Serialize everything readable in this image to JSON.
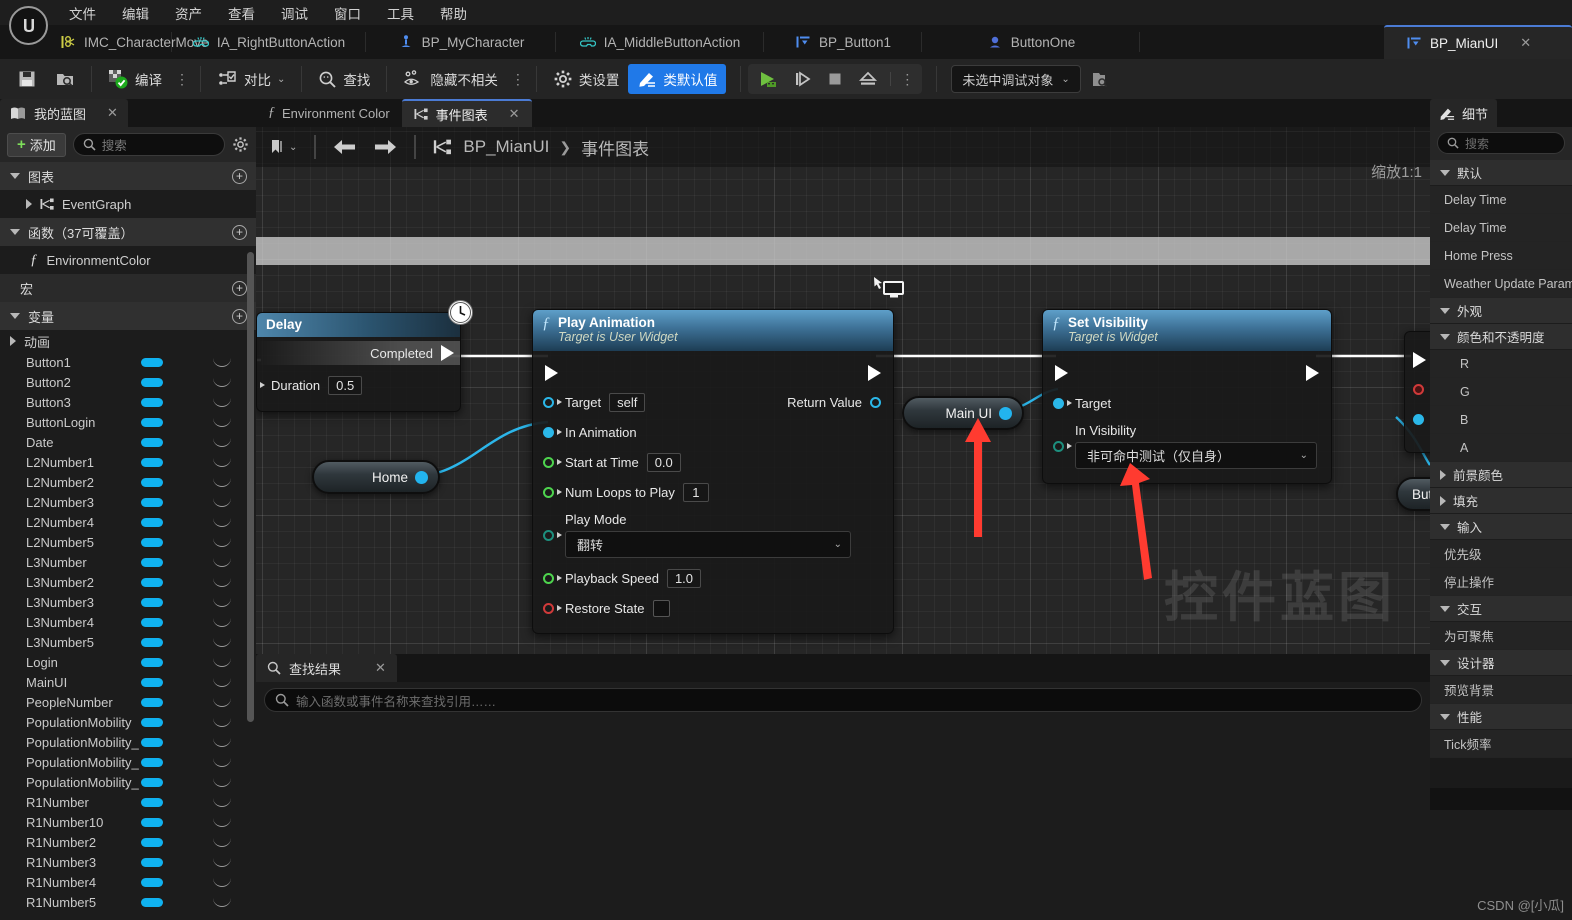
{
  "menubar": {
    "logo_icon": "unreal-engine-logo",
    "items": [
      "文件",
      "编辑",
      "资产",
      "查看",
      "调试",
      "窗口",
      "工具",
      "帮助"
    ]
  },
  "asset_tabs": [
    {
      "label": "IMC_CharacterMove",
      "icon": "input-mapping-context-icon",
      "active": false
    },
    {
      "label": "IA_RightButtonAction",
      "icon": "input-action-icon",
      "active": false
    },
    {
      "label": "BP_MyCharacter",
      "icon": "character-blueprint-icon",
      "active": false
    },
    {
      "label": "IA_MiddleButtonAction",
      "icon": "input-action-icon",
      "active": false
    },
    {
      "label": "BP_Button1",
      "icon": "widget-blueprint-icon",
      "active": false
    },
    {
      "label": "ButtonOne",
      "icon": "button-widget-icon",
      "active": false
    },
    {
      "label": "BP_MianUI",
      "icon": "widget-blueprint-icon",
      "active": true,
      "close_label": "✕"
    }
  ],
  "toolbar": {
    "save_icon": "save-icon",
    "browse_icon": "browse-content-icon",
    "compile_label": "编译",
    "compile_icon": "compile-check-icon",
    "diff_label": "对比",
    "diff_icon": "diff-icon",
    "find_label": "查找",
    "find_icon": "search-icon",
    "hide_unrelated_label": "隐藏不相关",
    "hide_unrelated_icon": "eye-hidden-icon",
    "class_settings_label": "类设置",
    "class_settings_icon": "gear-icon",
    "class_defaults_label": "类默认值",
    "class_defaults_icon": "pencil-lines-icon",
    "accent_color": "#2079e8",
    "play_icon": "play-icon",
    "step_icon": "step-forward-icon",
    "stop_icon": "stop-icon",
    "eject_icon": "eject-icon",
    "kebab": "⋮",
    "debug_object_label": "未选中调试对象",
    "debug_browse_icon": "browse-debug-icon"
  },
  "left_panel": {
    "tab_label": "我的蓝图",
    "tab_icon": "my-blueprint-icon",
    "tab_close": "✕",
    "add_label": "添加",
    "search_placeholder": "搜索",
    "settings_icon": "gear-icon",
    "sections": {
      "graphs_label": "图表",
      "graphs_items": [
        "EventGraph"
      ],
      "functions_label": "函数（37可覆盖）",
      "functions_items": [
        "EnvironmentColor"
      ],
      "macros_label": "宏",
      "variables_label": "变量",
      "animation_label": "动画"
    },
    "variables": [
      "Button1",
      "Button2",
      "Button3",
      "ButtonLogin",
      "Date",
      "L2Number1",
      "L2Number2",
      "L2Number3",
      "L2Number4",
      "L2Number5",
      "L3Number",
      "L3Number2",
      "L3Number3",
      "L3Number4",
      "L3Number5",
      "Login",
      "MainUI",
      "PeopleNumber",
      "PopulationMobility",
      "PopulationMobility_",
      "PopulationMobility_",
      "PopulationMobility_",
      "R1Number",
      "R1Number10",
      "R1Number2",
      "R1Number3",
      "R1Number4",
      "R1Number5"
    ],
    "variable_pill_color": "#10b2f0"
  },
  "graph": {
    "tabs": [
      {
        "label": "Environment Color",
        "icon": "function-fx-icon",
        "active": false
      },
      {
        "label": "事件图表",
        "icon": "event-graph-icon",
        "active": true,
        "close_label": "✕"
      }
    ],
    "breadcrumb": {
      "root": "BP_MianUI",
      "separator": "❯",
      "current": "事件图表",
      "icon": "event-graph-icon"
    },
    "nav_back_icon": "arrow-left-icon",
    "nav_forward_icon": "arrow-right-icon",
    "bookmark_icon": "bookmark-icon",
    "zoom_label": "缩放1:1",
    "watermark": "控件蓝图"
  },
  "nodes": {
    "delay": {
      "title": "Delay",
      "clock_icon": "clock-latent-icon",
      "output_exec_label": "Completed",
      "duration_label": "Duration",
      "duration_value": "0.5"
    },
    "play_animation": {
      "title": "Play Animation",
      "subtitle": "Target is User Widget",
      "fx_icon": "function-fx-icon",
      "target_label": "Target",
      "target_value": "self",
      "in_animation_label": "In Animation",
      "start_at_time_label": "Start at Time",
      "start_at_time_value": "0.0",
      "num_loops_label": "Num Loops to Play",
      "num_loops_value": "1",
      "play_mode_label": "Play Mode",
      "play_mode_value": "翻转",
      "playback_speed_label": "Playback Speed",
      "playback_speed_value": "1.0",
      "restore_state_label": "Restore State",
      "return_value_label": "Return Value"
    },
    "set_visibility": {
      "title": "Set Visibility",
      "subtitle": "Target is Widget",
      "fx_icon": "function-fx-icon",
      "target_label": "Target",
      "in_visibility_label": "In Visibility",
      "in_visibility_value": "非可命中测试（仅自身）"
    },
    "var_home": {
      "label": "Home"
    },
    "var_main_ui": {
      "label": "Main UI"
    },
    "var_button_right": {
      "label": "Butto"
    }
  },
  "find_panel": {
    "tab_label": "查找结果",
    "tab_icon": "search-icon",
    "tab_close": "✕",
    "search_placeholder": "输入函数或事件名称来查找引用……"
  },
  "right_panel": {
    "tab_label": "细节",
    "tab_icon": "details-pencil-icon",
    "search_placeholder": "搜索",
    "groups": [
      {
        "label": "默认",
        "expanded": true,
        "props": [
          "Delay Time",
          "Delay Time",
          "Home Press",
          "Weather Update Param"
        ]
      },
      {
        "label": "外观",
        "expanded": true,
        "props": []
      },
      {
        "label": "颜色和不透明度",
        "expanded": true,
        "sub_props": [
          "R",
          "G",
          "B",
          "A"
        ]
      },
      {
        "label": "前景颜色",
        "expanded": false,
        "props": []
      },
      {
        "label": "填充",
        "expanded": false,
        "props": []
      },
      {
        "label": "输入",
        "expanded": true,
        "props": [
          "优先级",
          "停止操作"
        ]
      },
      {
        "label": "交互",
        "expanded": true,
        "props": [
          "为可聚焦"
        ]
      },
      {
        "label": "设计器",
        "expanded": true,
        "props": [
          "预览背景"
        ]
      },
      {
        "label": "性能",
        "expanded": true,
        "props": [
          "Tick频率"
        ]
      }
    ]
  },
  "watermark_credit": "CSDN @[小瓜]"
}
